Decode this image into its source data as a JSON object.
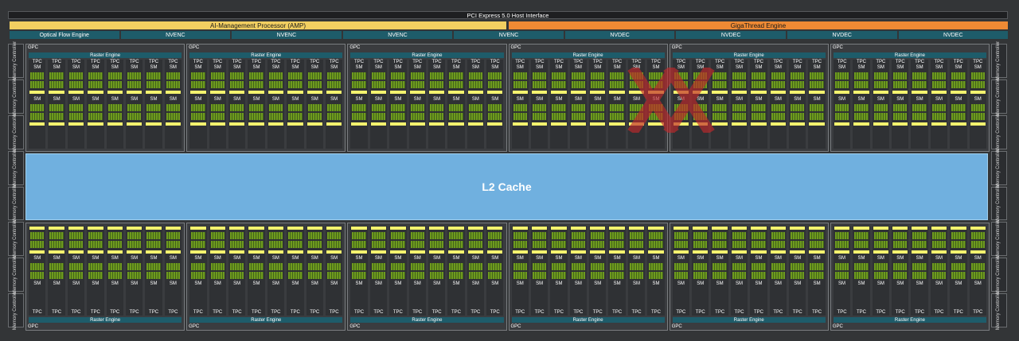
{
  "header": {
    "pcie": "PCI Express 5.0 Host Interface",
    "amp": "AI-Management Processor (AMP)",
    "gigathread": "GigaThread Engine"
  },
  "engines": [
    "Optical Flow Engine",
    "NVENC",
    "NVENC",
    "NVENC",
    "NVENC",
    "NVDEC",
    "NVDEC",
    "NVDEC",
    "NVDEC"
  ],
  "memory_controller_label": "Memory Controller",
  "memory_controllers_per_side": 8,
  "gpc": {
    "label": "GPC",
    "raster_label": "Raster Engine",
    "tpc_label": "TPC",
    "sm_label": "SM",
    "count_per_row": 6,
    "tpcs_per_gpc": 8
  },
  "l2_cache": "L2 Cache",
  "colors": {
    "amp": "#f2cf61",
    "gigathread": "#ef8a34",
    "engine": "#1e5c6a",
    "l2": "#70b0df",
    "sm_core": "#6e9a1e",
    "cache_bar": "#f4f36e",
    "watermark": "#c0292b"
  },
  "icons": [
    "watermark-logo-icon"
  ]
}
